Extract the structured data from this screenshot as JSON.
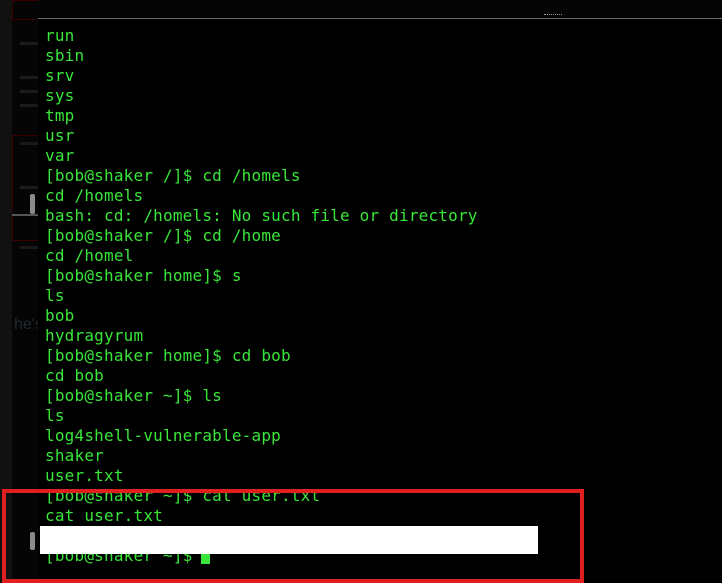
{
  "terminal": {
    "lines": [
      "run",
      "sbin",
      "srv",
      "sys",
      "tmp",
      "usr",
      "var",
      "[bob@shaker /]$ cd /homels",
      "cd /homels",
      "bash: cd: /homels: No such file or directory",
      "[bob@shaker /]$ cd /home",
      "cd /homel",
      "[bob@shaker home]$ s",
      "ls",
      "bob",
      "hydragyrum",
      "[bob@shaker home]$ cd bob",
      "cd bob",
      "[bob@shaker ~]$ ls",
      "ls",
      "log4shell-vulnerable-app",
      "shaker",
      "user.txt",
      "[bob@shaker ~]$ cat user.txt",
      "cat user.txt",
      "",
      "[bob@shaker ~]$"
    ],
    "text_color": "#39e639",
    "background": "#000000"
  },
  "background_window": {
    "visible_text": "he's home folder."
  },
  "annotation": {
    "highlight_color": "#e01f1f",
    "redaction_color": "#ffffff"
  }
}
